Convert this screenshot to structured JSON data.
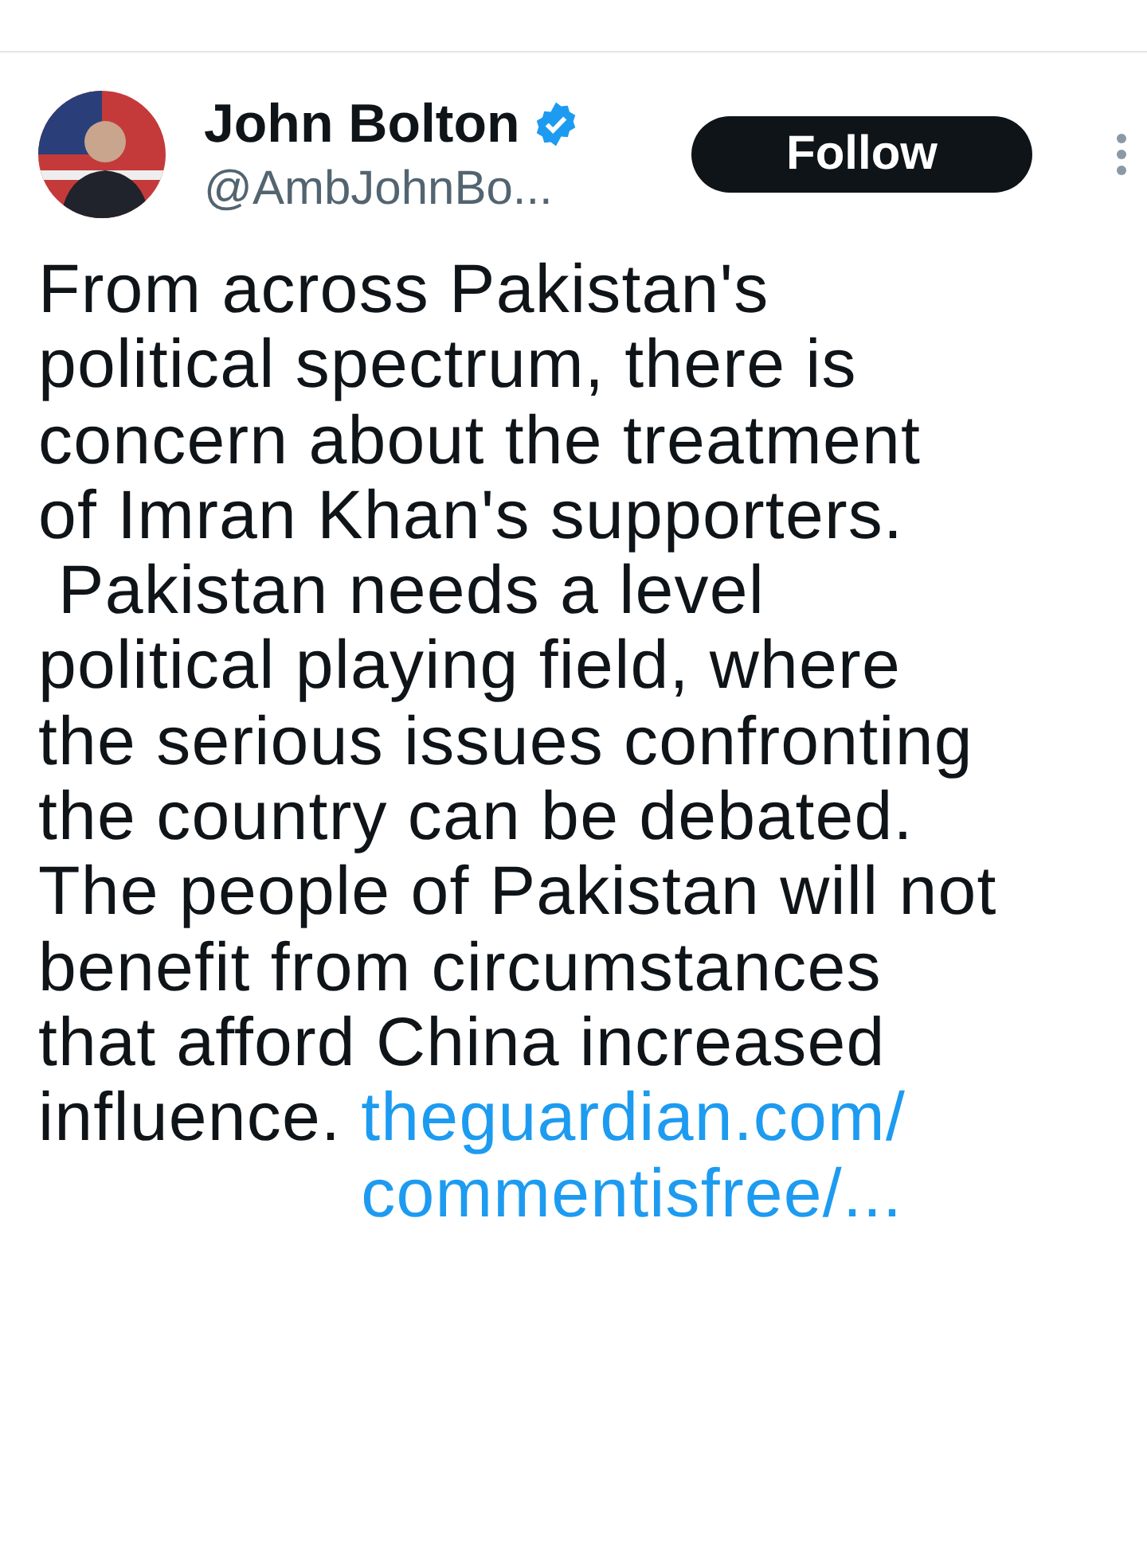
{
  "author": {
    "name": "John Bolton",
    "handle": "@AmbJohnBo...",
    "verified": true
  },
  "follow_button": "Follow",
  "body": "From across Pakistan's\npolitical spectrum, there is\nconcern about the treatment\nof Imran Khan's supporters.\n Pakistan needs a level\npolitical playing field, where\nthe serious issues confronting\nthe country can be debated.\nThe people of Pakistan will not\nbenefit from circumstances\nthat afford China increased\ninfluence. ",
  "link": "theguardian.com/\ncommentisfree/..."
}
